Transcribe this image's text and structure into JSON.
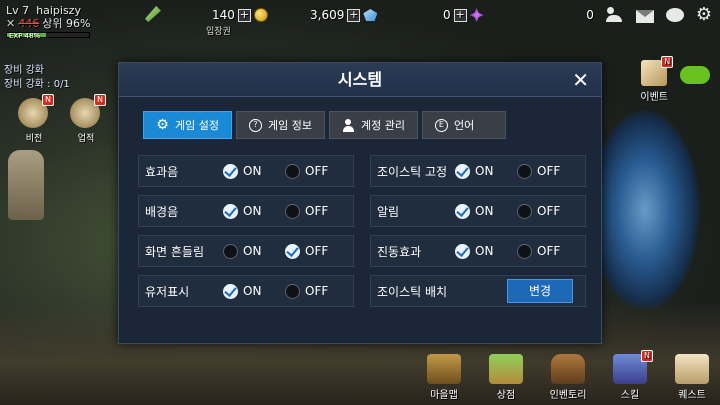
{
  "player": {
    "level": "Lv 7",
    "name": "haipiszy",
    "rank_prev": "446",
    "rank_text": "상위 96%",
    "exp_label": "EXP 48%",
    "exp_percent": 48
  },
  "currencies": {
    "ticket_label": "입장권",
    "gold": "140",
    "gems": "3,609",
    "crystals": "0"
  },
  "hud": {
    "friends_count": "0"
  },
  "quest": {
    "title": "장비 강화",
    "progress": "장비 강화 : 0/1"
  },
  "left_icons": [
    {
      "label": "비전"
    },
    {
      "label": "업적"
    }
  ],
  "event": {
    "label": "이벤트"
  },
  "bottom_menu": [
    {
      "label": "마을맵"
    },
    {
      "label": "상점"
    },
    {
      "label": "인벤토리"
    },
    {
      "label": "스킬"
    },
    {
      "label": "퀘스트"
    }
  ],
  "dialog": {
    "title": "시스템",
    "tabs": [
      {
        "label": "게임 설정",
        "icon": "gear-icon",
        "active": true
      },
      {
        "label": "게임 정보",
        "icon": "question-icon",
        "active": false
      },
      {
        "label": "계정 관리",
        "icon": "user-icon",
        "active": false
      },
      {
        "label": "언어",
        "icon": "e-icon",
        "active": false
      }
    ],
    "on_label": "ON",
    "off_label": "OFF",
    "settings_left": [
      {
        "label": "효과음",
        "value": "ON"
      },
      {
        "label": "배경음",
        "value": "ON"
      },
      {
        "label": "화면 흔들림",
        "value": "OFF"
      },
      {
        "label": "유저표시",
        "value": "ON"
      }
    ],
    "settings_right": [
      {
        "label": "조이스틱 고정",
        "value": "ON"
      },
      {
        "label": "알림",
        "value": "ON"
      },
      {
        "label": "진동효과",
        "value": "ON"
      }
    ],
    "joystick_layout": {
      "label": "조이스틱 배치",
      "button": "변경"
    }
  },
  "colors": {
    "tab_active": "#1b8ad6",
    "dialog_bg": "#1b2738",
    "check_on": "#1b6bc4"
  }
}
